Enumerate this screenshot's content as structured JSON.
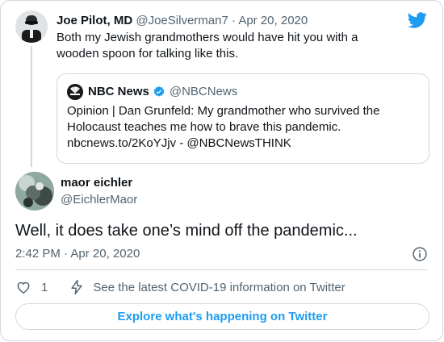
{
  "parent_tweet": {
    "author_name": "Joe Pilot, MD",
    "author_handle": "@JoeSilverman7",
    "separator": "·",
    "date": "Apr 20, 2020",
    "text": "Both my Jewish grandmothers would have hit you with a wooden spoon for talking like this.",
    "avatar_icon": "profile-photo-icon",
    "quoted_tweet": {
      "author_name": "NBC News",
      "author_handle": "@NBCNews",
      "verified": true,
      "text_line1": "Opinion | Dan Grunfeld: My grandmother who survived the",
      "text_line2": "Holocaust teaches me how to brave this pandemic.",
      "text_line3": "nbcnews.to/2KoYJjv - @NBCNewsTHINK"
    }
  },
  "main_tweet": {
    "author_name": "maor eichler",
    "author_handle": "@EichlerMaor",
    "text": "Well, it does take one’s mind off the pandemic...",
    "time": "2:42 PM",
    "separator": "·",
    "date": "Apr 20, 2020"
  },
  "actions": {
    "like_count": "1",
    "covid_info": "See the latest COVID-19 information on Twitter"
  },
  "explore_button": "Explore what's happening on Twitter",
  "colors": {
    "accent": "#1d9bf0",
    "border": "#cfd9de",
    "secondary_text": "#536471",
    "primary_text": "#0f1419"
  }
}
